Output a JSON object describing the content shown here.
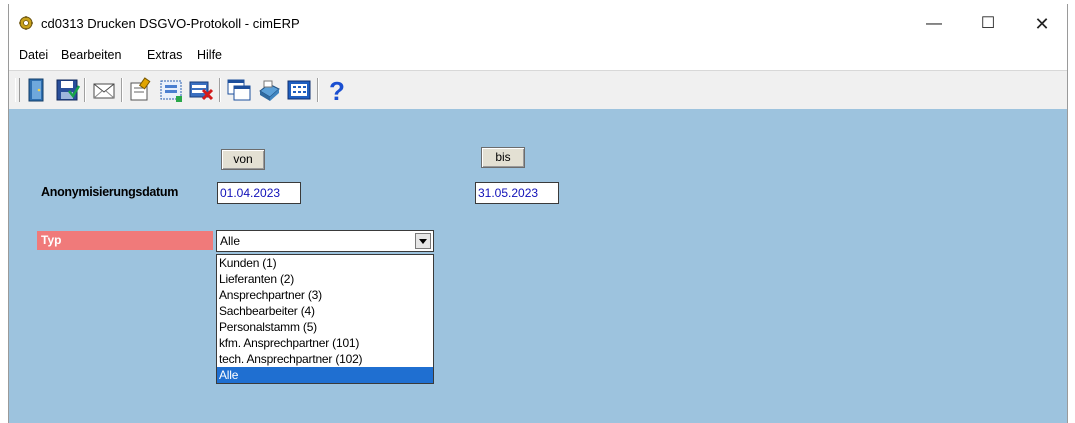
{
  "window": {
    "title": "cd0313 Drucken DSGVO-Protokoll - cimERP",
    "minimize": "—",
    "maximize": "☐",
    "close": "✕"
  },
  "menu": [
    "Datei",
    "Bearbeiten",
    "Extras",
    "Hilfe"
  ],
  "toolbar": {
    "icons": [
      "exit-door-icon",
      "save-icon",
      "mail-icon",
      "edit-form-icon",
      "select-area-icon",
      "delete-record-icon",
      "windows-icon",
      "print-icon",
      "calculator-icon",
      "help-icon"
    ],
    "help_symbol": "?"
  },
  "form": {
    "von_button": "von",
    "bis_button": "bis",
    "anonymisierung_label": "Anonymisierungsdatum",
    "date_from": "01.04.2023",
    "date_to": "31.05.2023",
    "typ_label": "Typ",
    "typ_selected": "Alle",
    "typ_options": [
      "Kunden (1)",
      "Lieferanten (2)",
      "Ansprechpartner (3)",
      "Sachbearbeiter (4)",
      "Personalstamm (5)",
      "kfm. Ansprechpartner (101)",
      "tech. Ansprechpartner (102)",
      "Alle"
    ],
    "typ_highlighted_index": 7
  },
  "colors": {
    "content_bg": "#9dc3de",
    "typ_label_bg": "#f07a7a",
    "date_text": "#1010b8",
    "selection": "#1f6fd1"
  }
}
